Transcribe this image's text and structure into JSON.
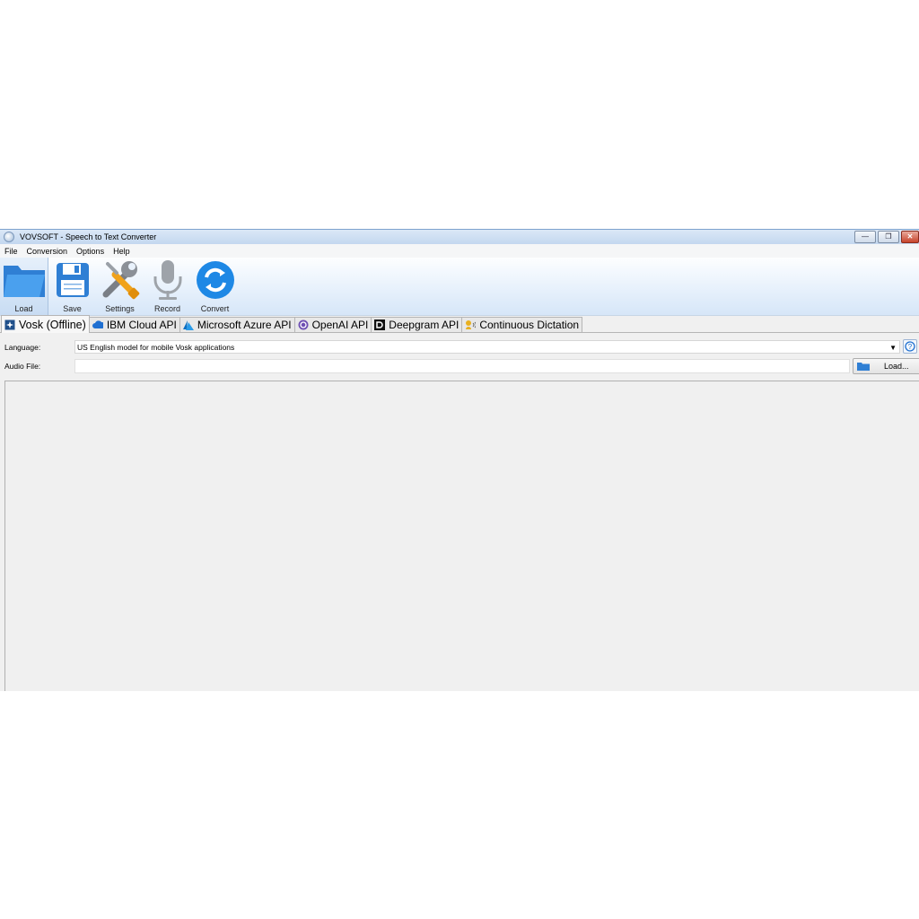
{
  "window": {
    "title": "VOVSOFT - Speech to Text Converter"
  },
  "menu": [
    "File",
    "Conversion",
    "Options",
    "Help"
  ],
  "toolbar": [
    {
      "label": "Load",
      "icon": "folder-open-icon"
    },
    {
      "label": "Save",
      "icon": "floppy-disk-icon"
    },
    {
      "label": "Settings",
      "icon": "tools-icon"
    },
    {
      "label": "Record",
      "icon": "microphone-icon"
    },
    {
      "label": "Convert",
      "icon": "refresh-icon"
    }
  ],
  "tabs": [
    {
      "label": "Vosk (Offline)",
      "icon": "vosk-icon",
      "active": true
    },
    {
      "label": "IBM Cloud API",
      "icon": "cloud-icon"
    },
    {
      "label": "Microsoft Azure API",
      "icon": "azure-icon"
    },
    {
      "label": "OpenAI API",
      "icon": "openai-icon"
    },
    {
      "label": "Deepgram API",
      "icon": "deepgram-icon"
    },
    {
      "label": "Continuous Dictation",
      "icon": "dictation-icon"
    }
  ],
  "form": {
    "language_label": "Language:",
    "language_value": "US English model for mobile Vosk applications",
    "audio_label": "Audio File:",
    "audio_value": "",
    "load_label": "Load..."
  },
  "colors": {
    "toolbar_blue": "#3d8ee0",
    "accent": "#1e88e5"
  }
}
